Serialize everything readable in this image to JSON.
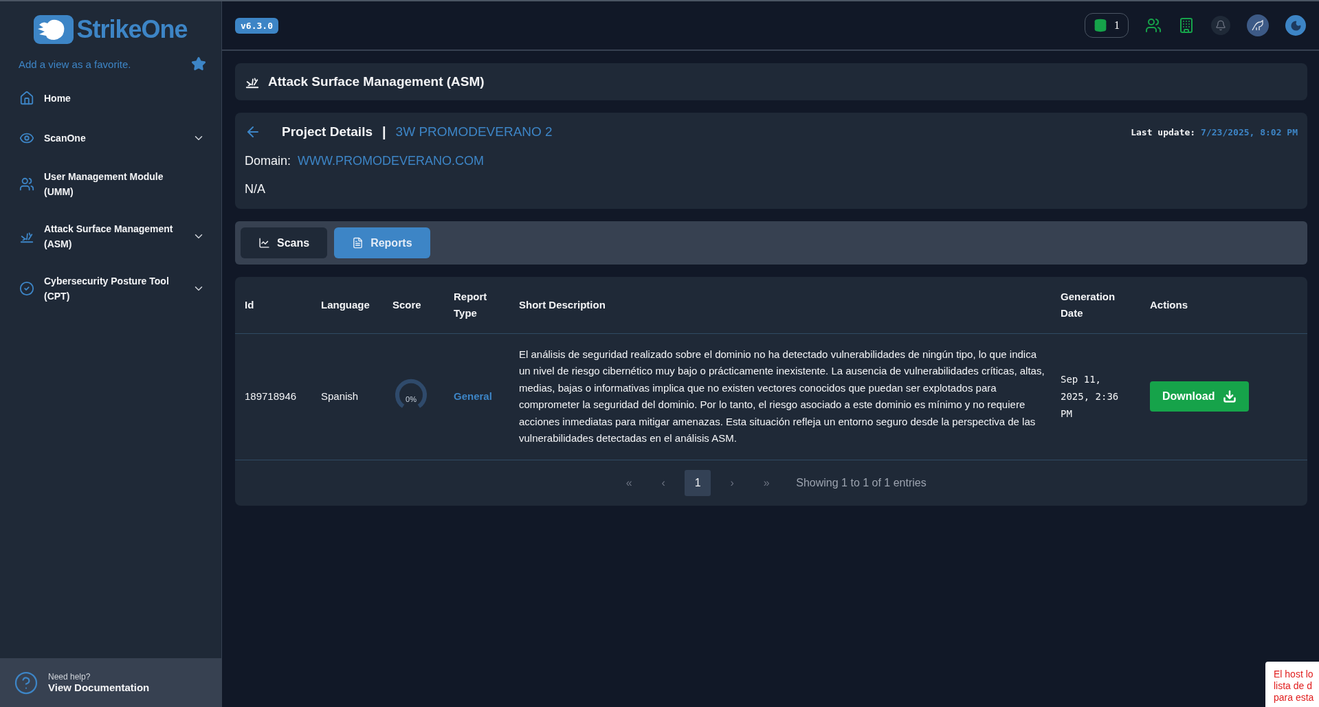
{
  "sidebar": {
    "logo": "StrikeOne",
    "favorite_hint": "Add a view as a favorite.",
    "items": [
      {
        "label": "Home",
        "kind": "link"
      },
      {
        "label": "ScanOne",
        "kind": "group"
      },
      {
        "label": "User Management Module (UMM)",
        "kind": "link"
      },
      {
        "label": "Attack Surface Management (ASM)",
        "kind": "group"
      },
      {
        "label": "Cybersecurity Posture Tool (CPT)",
        "kind": "group"
      }
    ],
    "help": {
      "caption": "Need help?",
      "link": "View Documentation"
    }
  },
  "topbar": {
    "version": "v6.3.0",
    "credits": "1"
  },
  "page_title": "Attack Surface Management (ASM)",
  "project": {
    "heading": "Project Details",
    "separator": "|",
    "name": "3W PROMODEVERANO 2",
    "last_update_label": "Last update:",
    "last_update": "7/23/2025, 8:02 PM",
    "domain_label": "Domain:",
    "domain": "WWW.PROMODEVERANO.COM",
    "note": "N/A"
  },
  "tabs": [
    {
      "label": "Scans",
      "selected": false
    },
    {
      "label": "Reports",
      "selected": true
    }
  ],
  "table": {
    "columns": [
      "Id",
      "Language",
      "Score",
      "Report Type",
      "Short Description",
      "Generation Date",
      "Actions"
    ],
    "rows": [
      {
        "id": "189718946",
        "language": "Spanish",
        "score": "0%",
        "report_type": "General",
        "description": "El análisis de seguridad realizado sobre el dominio no ha detectado vulnerabilidades de ningún tipo, lo que indica un nivel de riesgo cibernético muy bajo o prácticamente inexistente. La ausencia de vulnerabilidades críticas, altas, medias, bajas o informativas implica que no existen vectores conocidos que puedan ser explotados para comprometer la seguridad del dominio. Por lo tanto, el riesgo asociado a este dominio es mínimo y no requiere acciones inmediatas para mitigar amenazas. Esta situación refleja un entorno seguro desde la perspectiva de las vulnerabilidades detectadas en el análisis ASM.",
        "date": "Sep 11, 2025, 2:36 PM",
        "action": "Download"
      }
    ]
  },
  "pagination": {
    "first": "«",
    "prev": "‹",
    "pages": [
      {
        "label": "1",
        "selected": true
      }
    ],
    "next": "›",
    "last": "»",
    "summary": "Showing 1 to 1 of 1 entries"
  },
  "toast": {
    "lines": [
      "El host lo",
      "lista de d",
      "para esta"
    ]
  }
}
